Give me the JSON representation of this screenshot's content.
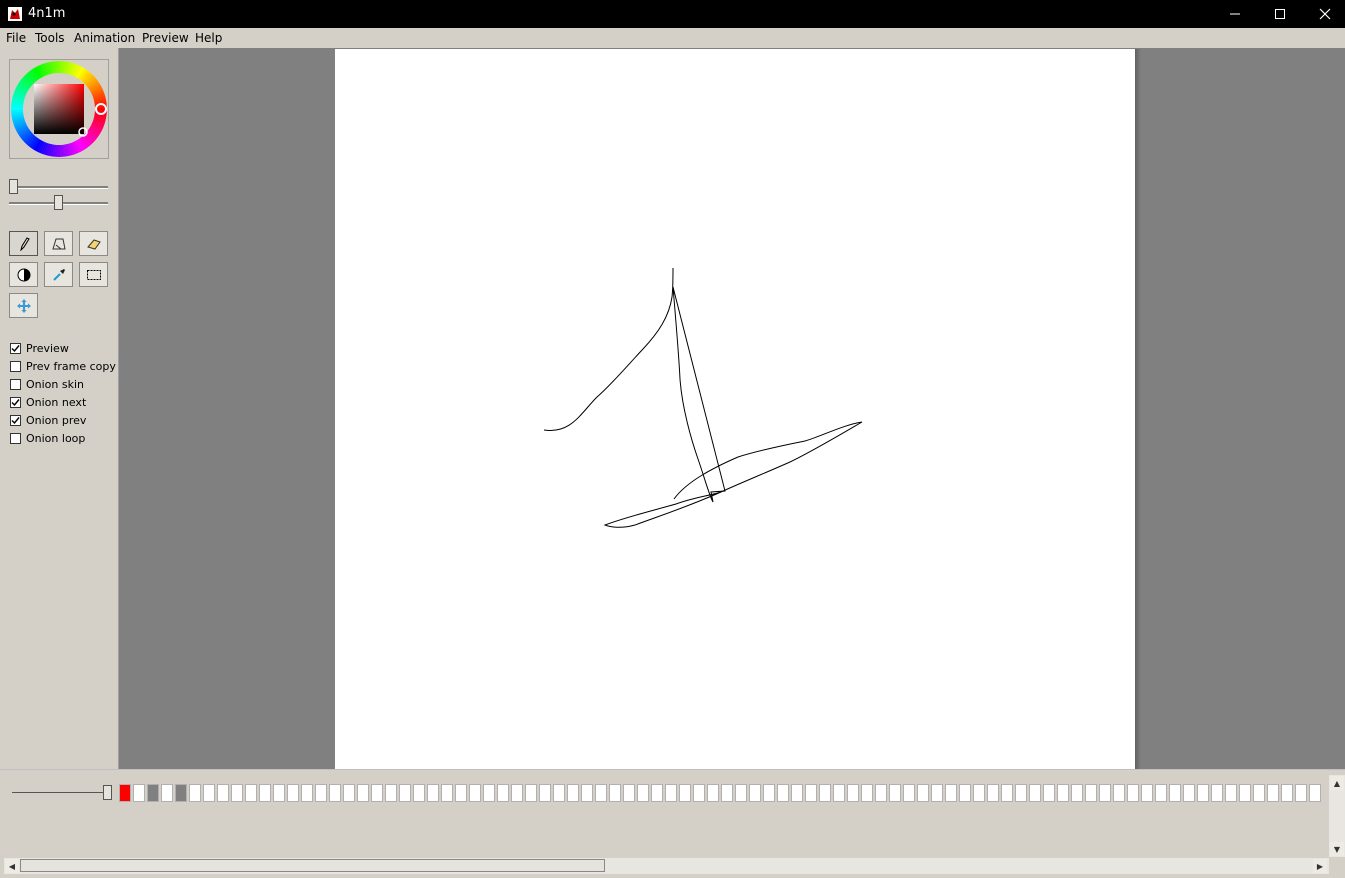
{
  "window": {
    "title": "4n1m"
  },
  "menubar": {
    "items": [
      "File",
      "Tools",
      "Animation",
      "Preview",
      "Help"
    ]
  },
  "colors": {
    "primary": "#ff0000",
    "hue_marker": "#ff1a1a",
    "workspace_bg": "#808080",
    "panel_bg": "#d4d0c8",
    "stroke": "#000000"
  },
  "tools": [
    {
      "name": "pen-tool",
      "icon": "pencil-icon",
      "active": true
    },
    {
      "name": "shape-tool",
      "icon": "polygon-icon",
      "active": false
    },
    {
      "name": "eraser-tool",
      "icon": "eraser-icon",
      "active": false
    },
    {
      "name": "invert-tool",
      "icon": "contrast-icon",
      "active": false
    },
    {
      "name": "eyedropper-tool",
      "icon": "eyedropper-icon",
      "active": false
    },
    {
      "name": "select-tool",
      "icon": "marquee-icon",
      "active": false
    },
    {
      "name": "move-tool",
      "icon": "move-icon",
      "active": false
    }
  ],
  "options": [
    {
      "label": "Preview",
      "checked": true
    },
    {
      "label": "Prev frame copy",
      "checked": false
    },
    {
      "label": "Onion skin",
      "checked": false
    },
    {
      "label": "Onion next",
      "checked": true
    },
    {
      "label": "Onion prev",
      "checked": true
    },
    {
      "label": "Onion loop",
      "checked": false
    }
  ],
  "sliders": {
    "size_level": 0.0,
    "opacity_level": 0.5,
    "timeline_zoom_level": 1.0
  },
  "timeline": {
    "frames": [
      {
        "state": "current",
        "color": "#ff0000"
      },
      {
        "state": "empty",
        "color": "#ffffff"
      },
      {
        "state": "keyframe",
        "color": "#808080"
      },
      {
        "state": "empty",
        "color": "#ffffff"
      },
      {
        "state": "keyframe",
        "color": "#808080"
      }
    ],
    "empty_frame_color": "#ffffff"
  }
}
